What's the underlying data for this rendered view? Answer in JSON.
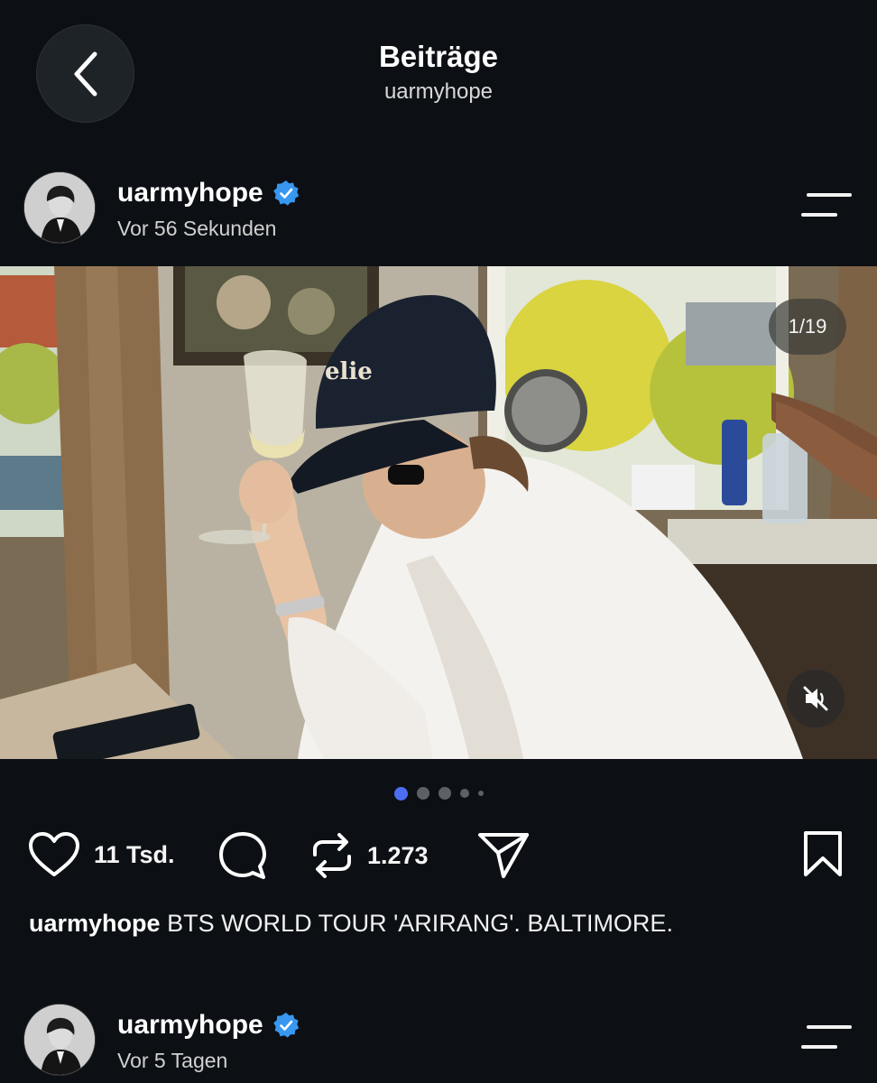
{
  "header": {
    "title": "Beiträge",
    "subtitle": "uarmyhope",
    "back_icon": "chevron-left-icon"
  },
  "posts": [
    {
      "username": "uarmyhope",
      "verified": true,
      "time": "Vor 56 Sekunden",
      "media_counter": "1/19",
      "muted_icon": "speaker-muted-icon",
      "carousel_dots": 5,
      "carousel_active_index": 0,
      "likes": "11 Tsd.",
      "reposts": "1.273",
      "caption_user": "uarmyhope",
      "caption_text": "BTS WORLD TOUR 'ARIRANG'. BALTIMORE."
    },
    {
      "username": "uarmyhope",
      "verified": true,
      "time": "Vor 5 Tagen"
    }
  ],
  "colors": {
    "background": "#0c1014",
    "verified_badge": "#3897f0",
    "active_dot": "#4c6ef5"
  }
}
